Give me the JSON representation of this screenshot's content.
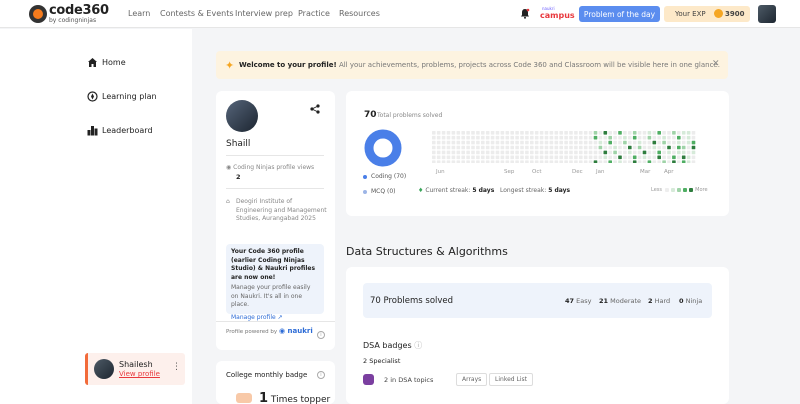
{
  "header": {
    "logo_main": "code360",
    "logo_sub": "by codingninjas",
    "nav": [
      "Learn",
      "Contests & Events",
      "Interview prep",
      "Practice",
      "Resources"
    ],
    "campus_small": "naukri",
    "campus_main": "campus",
    "potd_label": "Problem of the day",
    "exp_label": "Your EXP",
    "exp_value": "3900"
  },
  "sidebar": {
    "items": [
      {
        "label": "Home",
        "icon": "home-icon"
      },
      {
        "label": "Learning plan",
        "icon": "compass-icon"
      },
      {
        "label": "Leaderboard",
        "icon": "leaderboard-icon"
      }
    ],
    "user": {
      "name": "Shailesh",
      "view_profile": "View profile"
    }
  },
  "banner": {
    "title": "Welcome to your profile!",
    "text": "All your achievements, problems, projects across Code 360 and Classroom will be visible here in one glance."
  },
  "profile": {
    "name": "Shaill",
    "views_label": "Coding Ninjas profile views",
    "views": "2",
    "institute": "Deogiri Institute of Engineering and Management Studies, Aurangabad 2025",
    "note_title": "Your Code 360 profile (earlier Coding Ninjas Studio) & Naukri profiles are now one!",
    "note_desc": "Manage your profile easily on Naukri. It's all in one place.",
    "manage_link": "Manage profile",
    "powered_by": "Profile powered by",
    "naukri": "naukri"
  },
  "college": {
    "title": "College monthly badge",
    "rank_num": "1",
    "rank_text": "Times topper"
  },
  "problems": {
    "total": "70",
    "total_label": "Total problems solved",
    "coding_label": "Coding (70)",
    "mcq_label": "MCQ (0)",
    "months": [
      "Jun",
      "Sep",
      "Oct",
      "Dec",
      "Jan",
      "Mar",
      "Apr"
    ],
    "current_streak_label": "Current streak:",
    "current_streak": "5 days",
    "longest_streak_label": "Longest streak:",
    "longest_streak": "5 days",
    "less": "Less",
    "more": "More",
    "colors": {
      "coding": "#4a7fe8",
      "mcq": "#9db5e6",
      "accent": "#5b8def"
    }
  },
  "dsa": {
    "title": "Data Structures & Algorithms",
    "solved": "70 Problems solved",
    "easy_n": "47",
    "easy": "Easy",
    "moderate_n": "21",
    "moderate": "Moderate",
    "hard_n": "2",
    "hard": "Hard",
    "ninja_n": "0",
    "ninja": "Ninja",
    "badges_title": "DSA badges",
    "specialist": "2 Specialist",
    "badge_text": "2 in DSA topics",
    "topics": [
      "Arrays",
      "Linked List"
    ]
  }
}
